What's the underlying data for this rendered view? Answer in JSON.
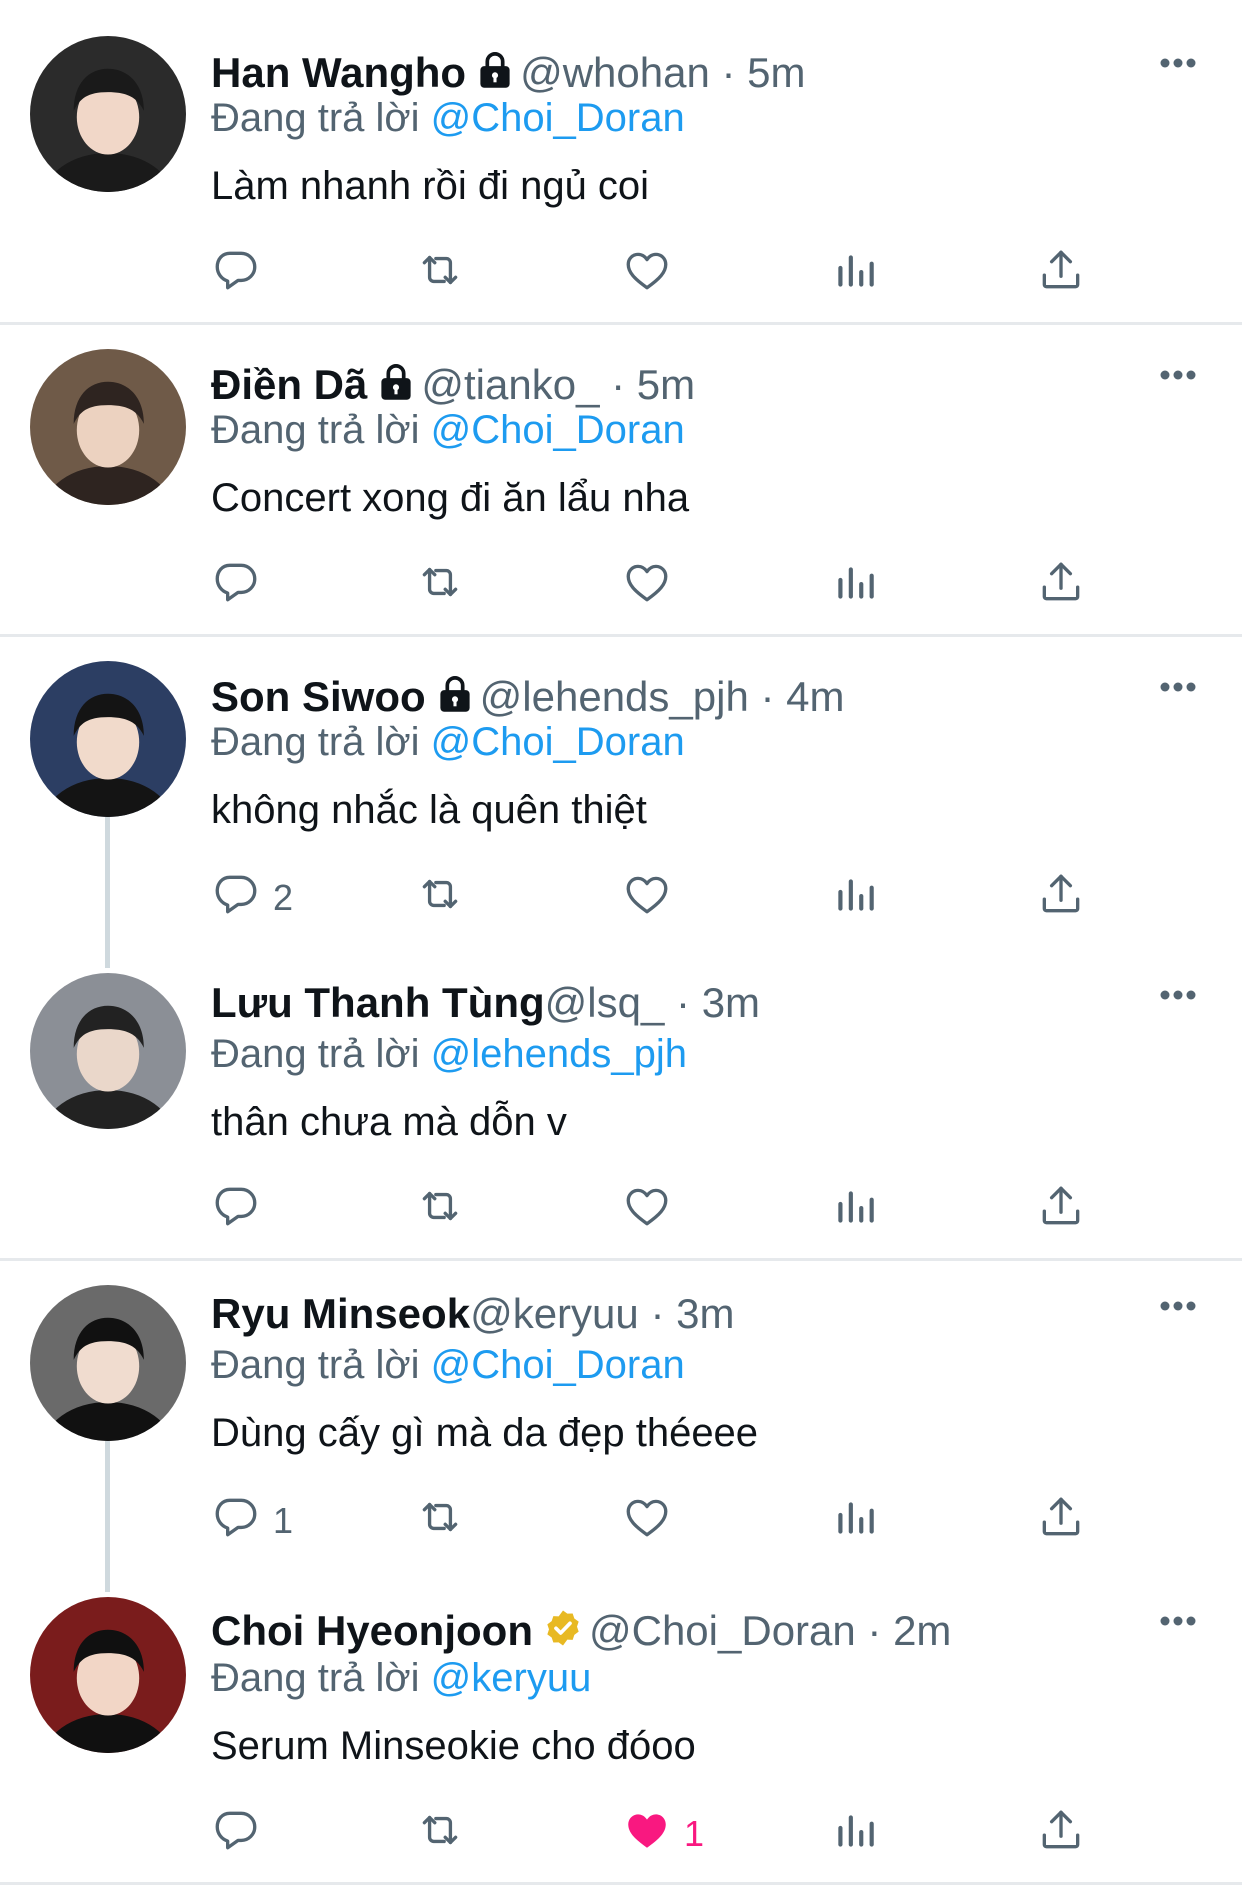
{
  "reply_prefix": "Đang trả lời",
  "tweets": [
    {
      "name": "Han Wangho",
      "protected": true,
      "verified": false,
      "handle": "@whohan",
      "time": "5m",
      "reply_to": "@Choi_Doran",
      "text": "Làm nhanh rồi đi ngủ coi",
      "replies": "",
      "likes": "",
      "liked": false,
      "avatar_colors": [
        "#2b2b2b",
        "#f1d7c8",
        "#1a1a1a"
      ]
    },
    {
      "name": "Điền Dã",
      "protected": true,
      "verified": false,
      "handle": "@tianko_",
      "time": "5m",
      "reply_to": "@Choi_Doran",
      "text": "Concert xong đi ăn lẩu nha",
      "replies": "",
      "likes": "",
      "liked": false,
      "avatar_colors": [
        "#6f5a48",
        "#ecd2c0",
        "#2e2420"
      ]
    },
    {
      "name": "Son Siwoo",
      "protected": true,
      "verified": false,
      "handle": "@lehends_pjh",
      "time": "4m",
      "reply_to": "@Choi_Doran",
      "text": "không nhắc là quên thiệt",
      "replies": "2",
      "likes": "",
      "liked": false,
      "avatar_colors": [
        "#2c3e63",
        "#f1dacb",
        "#141414"
      ]
    },
    {
      "name": "Lưu Thanh Tùng",
      "protected": false,
      "verified": false,
      "handle": "@lsq_",
      "time": "3m",
      "reply_to": "@lehends_pjh",
      "text": "thân chưa mà dỗn v",
      "replies": "",
      "likes": "",
      "liked": false,
      "avatar_colors": [
        "#8b8f96",
        "#ead7ca",
        "#222222"
      ]
    },
    {
      "name": "Ryu Minseok",
      "protected": false,
      "verified": false,
      "handle": "@keryuu",
      "time": "3m",
      "reply_to": "@Choi_Doran",
      "text": "Dùng cấy gì mà da đẹp théeee",
      "replies": "1",
      "likes": "",
      "liked": false,
      "avatar_colors": [
        "#6a6a6a",
        "#f0dccf",
        "#111111"
      ]
    },
    {
      "name": "Choi Hyeonjoon",
      "protected": false,
      "verified": true,
      "handle": "@Choi_Doran",
      "time": "2m",
      "reply_to": "@keryuu",
      "text": "Serum Minseokie cho đóoo",
      "replies": "",
      "likes": "1",
      "liked": true,
      "avatar_colors": [
        "#7a1c1c",
        "#f2d6c6",
        "#101010"
      ]
    }
  ],
  "icons": {
    "reply": "reply-icon",
    "retweet": "retweet-icon",
    "like": "heart-icon",
    "views": "views-icon",
    "share": "share-icon",
    "more": "more-icon",
    "lock": "lock-icon",
    "verified": "verified-badge-icon"
  },
  "colors": {
    "mention": "#1d9bf0",
    "secondary": "#536471",
    "like": "#f91880",
    "verified": "#e8b923"
  }
}
